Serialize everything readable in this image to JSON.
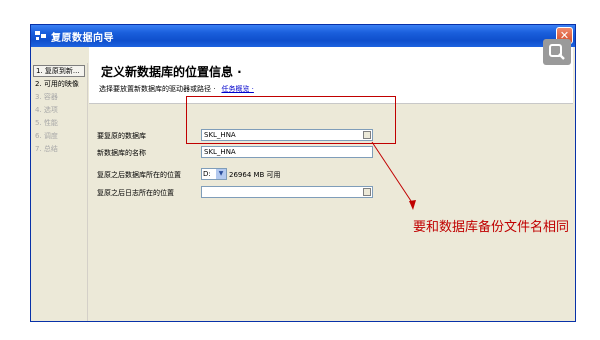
{
  "window": {
    "title": "复原数据向导",
    "close_glyph": "✕"
  },
  "sidebar": {
    "items": [
      {
        "label": "1. 复原到新...",
        "state": "active"
      },
      {
        "label": "2. 可用的映像",
        "state": "normal"
      },
      {
        "label": "3. 容器",
        "state": "disabled"
      },
      {
        "label": "4. 选项",
        "state": "disabled"
      },
      {
        "label": "5. 性能",
        "state": "disabled"
      },
      {
        "label": "6. 调度",
        "state": "disabled"
      },
      {
        "label": "7. 总结",
        "state": "disabled"
      }
    ]
  },
  "header": {
    "title": "定义新数据库的位置信息 ·",
    "instruction": "选择要放置新数据库的驱动器或路径 ·",
    "task_link": "任务概览 ·"
  },
  "form": {
    "db_to_restore": {
      "label": "要复原的数据库",
      "value": "SKL_HNA"
    },
    "new_db_name": {
      "label": "新数据库的名称",
      "value": "SKL_HNA"
    },
    "db_location": {
      "label": "复原之后数据库所在的位置",
      "drive": "D:",
      "free_space": "26964 MB 可用"
    },
    "log_location": {
      "label": "复原之后日志所在的位置",
      "value": ""
    }
  },
  "annotation": {
    "note": "要和数据库备份文件名相同",
    "color": "#c00000"
  },
  "colors": {
    "titlebar": "#0f4fcc",
    "window_bg": "#ece9d8",
    "annotation_red": "#c00000"
  }
}
